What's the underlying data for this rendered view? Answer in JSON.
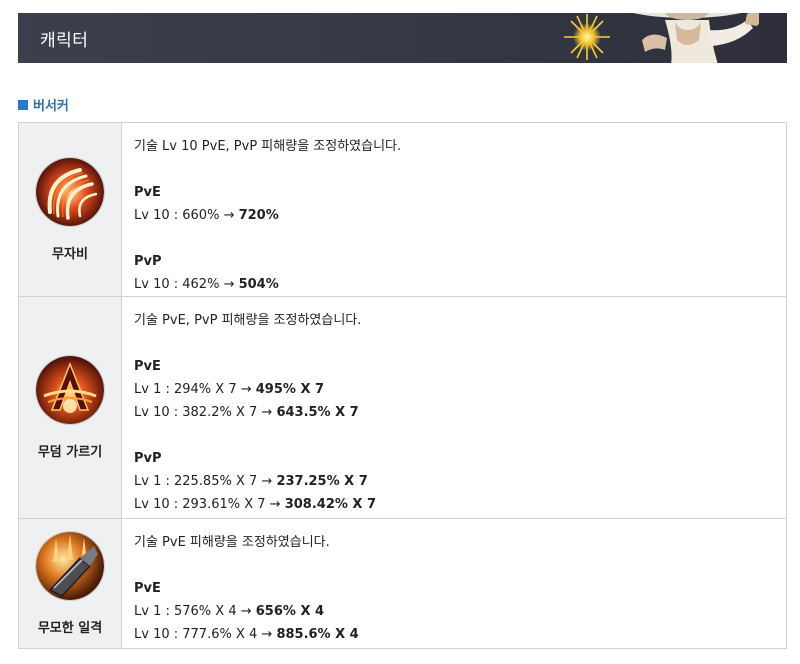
{
  "header": {
    "title": "캐릭터"
  },
  "section": {
    "label": "버서커"
  },
  "skills": [
    {
      "name": "무자비",
      "note": "기술 Lv 10 PvE, PvP 피해량을 조정하였습니다.",
      "pve_label": "PvE",
      "pve": [
        {
          "level": "Lv 10 : ",
          "old": "660% → ",
          "new": "720%"
        }
      ],
      "pvp_label": "PvP",
      "pvp": [
        {
          "level": "Lv 10 : ",
          "old": "462% → ",
          "new": "504%"
        }
      ],
      "icon": "claw-slash-icon"
    },
    {
      "name": "무덤 가르기",
      "note": "기술 PvE, PvP 피해량을 조정하였습니다.",
      "pve_label": "PvE",
      "pve": [
        {
          "level": "Lv 1 : ",
          "old": "294% X 7 → ",
          "new": "495% X 7"
        },
        {
          "level": "Lv 10 : ",
          "old": "382.2% X 7 → ",
          "new": "643.5% X 7"
        }
      ],
      "pvp_label": "PvP",
      "pvp": [
        {
          "level": "Lv 1 : ",
          "old": "225.85% X 7 → ",
          "new": "237.25% X 7"
        },
        {
          "level": "Lv 10 : ",
          "old": "293.61% X 7 → ",
          "new": "308.42% X 7"
        }
      ],
      "icon": "grave-split-icon"
    },
    {
      "name": "무모한 일격",
      "note": "기술 PvE 피해량을 조정하였습니다.",
      "pve_label": "PvE",
      "pve": [
        {
          "level": "Lv 1 : ",
          "old": "576% X 4 → ",
          "new": "656% X 4"
        },
        {
          "level": "Lv 10 : ",
          "old": "777.6% X 4 → ",
          "new": "885.6% X 4"
        }
      ],
      "icon": "reckless-strike-icon"
    }
  ],
  "colors": {
    "header_bg": "#3a3c48",
    "accent": "#2a7bc3",
    "row_bg": "#eef0f2",
    "border": "#cfd3d8"
  }
}
